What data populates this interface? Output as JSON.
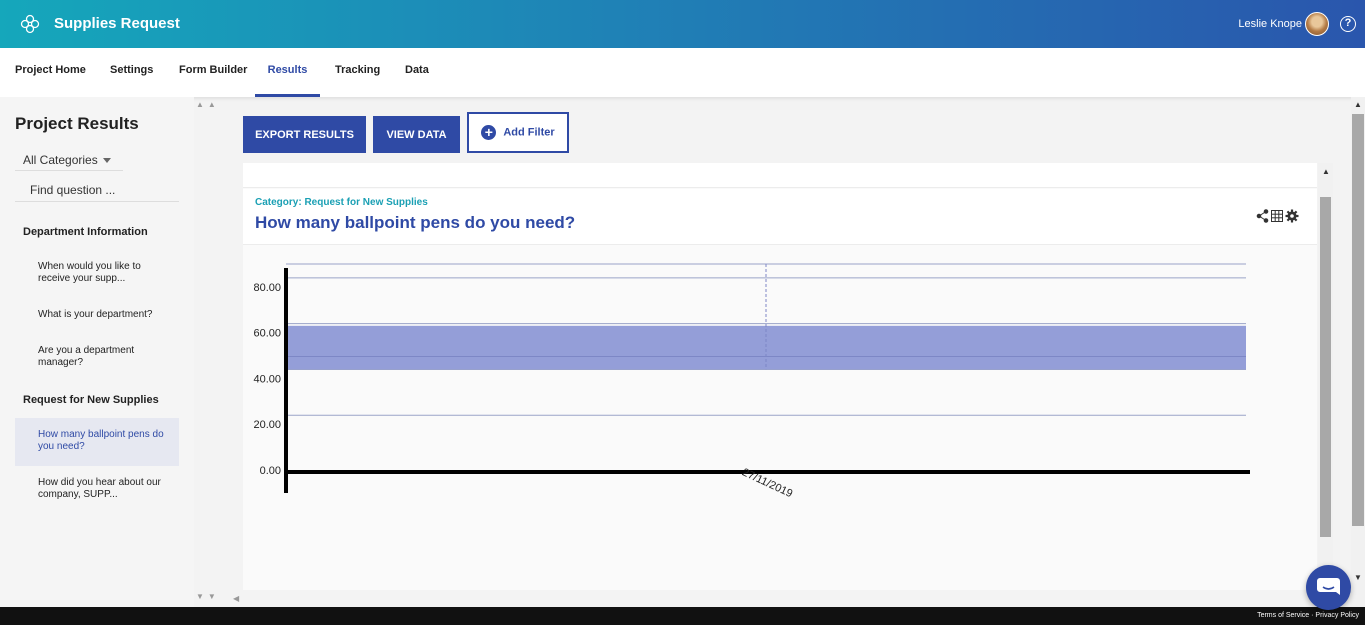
{
  "header": {
    "app_title": "Supplies Request",
    "user_name": "Leslie Knope",
    "help_glyph": "?",
    "icons": [
      "flower-logo-icon",
      "help-icon"
    ]
  },
  "nav": {
    "tabs": [
      {
        "label": "Project Home"
      },
      {
        "label": "Settings"
      },
      {
        "label": "Form Builder"
      },
      {
        "label": "Results",
        "active": true
      },
      {
        "label": "Tracking"
      },
      {
        "label": "Data"
      }
    ]
  },
  "sidebar": {
    "title": "Project Results",
    "category_select": "All Categories",
    "search_placeholder": "Find question ...",
    "groups": [
      {
        "name": "Department Information",
        "items": [
          {
            "label": "When would you like to receive your supp..."
          },
          {
            "label": "What is your department?"
          },
          {
            "label": "Are you a department manager?"
          }
        ]
      },
      {
        "name": "Request for New Supplies",
        "items": [
          {
            "label": "How many ballpoint pens do you need?",
            "active": true
          },
          {
            "label": "How did you hear about our company, SUPP..."
          }
        ]
      }
    ]
  },
  "toolbar": {
    "export_label": "EXPORT RESULTS",
    "view_data_label": "VIEW DATA",
    "add_filter_label": "Add Filter"
  },
  "question": {
    "category": "Category: Request for New Supplies",
    "title": "How many ballpoint pens do you need?"
  },
  "chart_data": {
    "type": "area",
    "y_ticks": [
      "80.00",
      "60.00",
      "40.00",
      "20.00",
      "0.00"
    ],
    "ylim": [
      0,
      90
    ],
    "x": [
      "27/11/2019"
    ],
    "band": {
      "low": 44,
      "high": 63
    },
    "grid": true,
    "colors": {
      "band": "#949ed8",
      "grid": "#9aa3c8",
      "axis": "#000000"
    }
  },
  "footer": {
    "terms": "Terms of Service",
    "privacy": "Privacy Policy"
  },
  "colors": {
    "brand": "#2f4aa5",
    "accent": "#1ba0b4"
  }
}
